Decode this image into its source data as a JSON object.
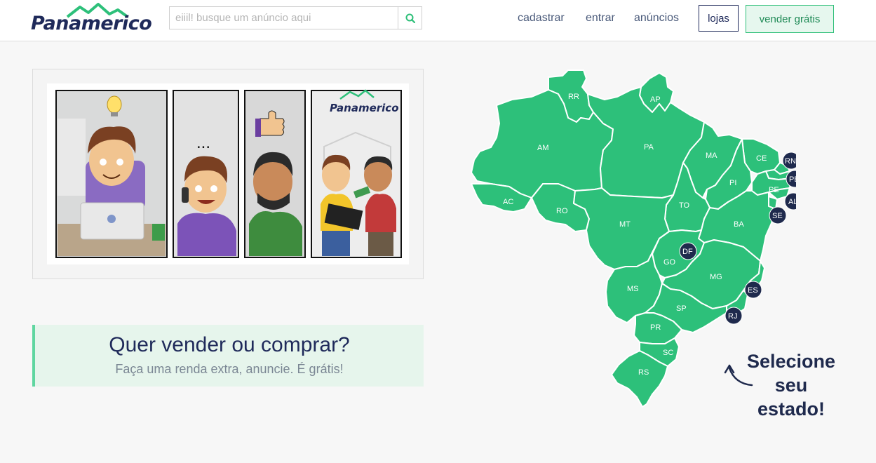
{
  "header": {
    "logo_text": "Panamerico",
    "search": {
      "placeholder": "eiiil! busque um anúncio aqui",
      "value": "",
      "button_icon": "search-icon"
    },
    "nav": {
      "cadastrar": "cadastrar",
      "entrar": "entrar",
      "anuncios": "anúncios"
    },
    "lojas_label": "lojas",
    "vender_label": "vender grátis"
  },
  "comic": {
    "logo_text": "Panamerico",
    "dots": "..."
  },
  "cta": {
    "title": "Quer vender ou comprar?",
    "subtitle": "Faça uma renda extra, anuncie. É grátis!"
  },
  "map": {
    "states": [
      "RR",
      "AP",
      "AM",
      "PA",
      "MA",
      "CE",
      "PI",
      "AC",
      "RO",
      "TO",
      "PE",
      "MT",
      "BA",
      "GO",
      "MG",
      "MS",
      "SP",
      "PR",
      "SC",
      "RS"
    ],
    "badges": [
      "RN",
      "PB",
      "AL",
      "SE",
      "DF",
      "ES",
      "RJ"
    ],
    "select_text": [
      "Selecione",
      "seu",
      "estado!"
    ]
  },
  "colors": {
    "brand_navy": "#1f2a5a",
    "brand_green": "#2dc07a",
    "badge": "#1f2a4d",
    "cta_bg": "#e6f5ec"
  }
}
